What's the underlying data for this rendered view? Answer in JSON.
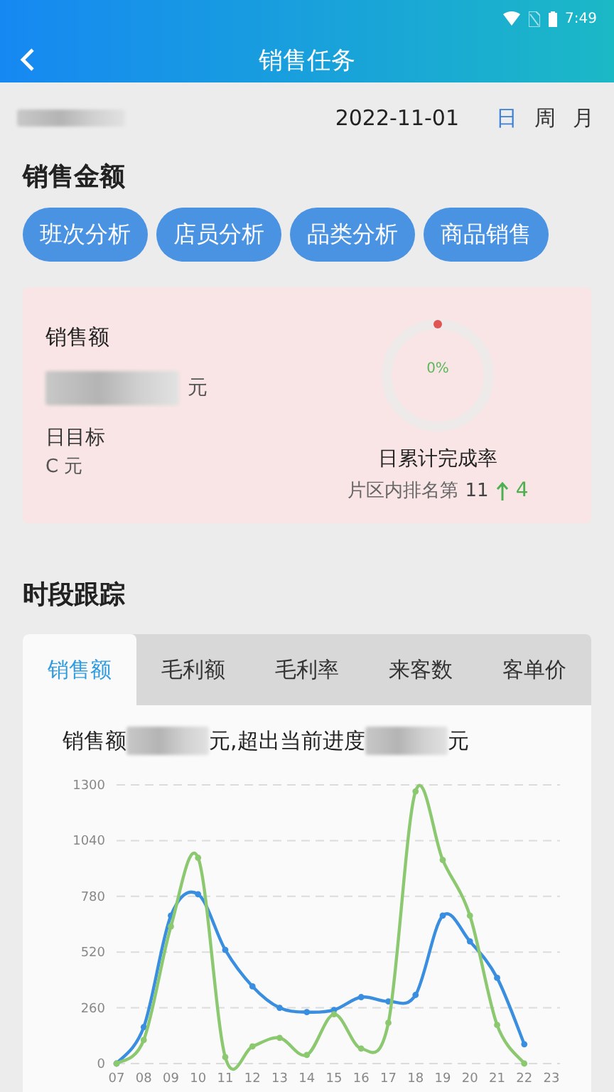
{
  "status_bar": {
    "time": "7:49"
  },
  "header": {
    "title": "销售任务"
  },
  "date_bar": {
    "date": "2022-11-01",
    "periods": [
      {
        "label": "日",
        "selected": true
      },
      {
        "label": "周",
        "selected": false
      },
      {
        "label": "月",
        "selected": false
      }
    ]
  },
  "sales_amount": {
    "title": "销售金额",
    "buttons": [
      "班次分析",
      "店员分析",
      "品类分析",
      "商品销售"
    ],
    "card": {
      "label": "销售额",
      "unit": "元",
      "target_label": "日目标",
      "target_value": "C 元",
      "progress": {
        "level": 0,
        "reading": "0%",
        "caption": "日累计完成率"
      },
      "rank_label": "片区内排名第",
      "rank": "11",
      "rank_change": "4"
    }
  },
  "period_tracking": {
    "title": "时段跟踪",
    "tabs": [
      {
        "label": "销售额",
        "selected": true
      },
      {
        "label": "毛利额",
        "selected": false
      },
      {
        "label": "毛利率",
        "selected": false
      },
      {
        "label": "来客数",
        "selected": false
      },
      {
        "label": "客单价",
        "selected": false
      }
    ],
    "summary_parts": [
      "销售额",
      "元,超出当前进度",
      "元"
    ],
    "chart_data": {
      "type": "line",
      "categories": [
        "07",
        "08",
        "09",
        "10",
        "11",
        "12",
        "13",
        "14",
        "15",
        "16",
        "17",
        "18",
        "19",
        "20",
        "21",
        "22",
        "23"
      ],
      "yticks": [
        0,
        260,
        520,
        780,
        1040,
        1300
      ],
      "ylim": [
        0,
        1300
      ],
      "grid": true,
      "series": [
        {
          "color": "#3a8ee0",
          "marker": true,
          "values": [
            0,
            170,
            690,
            790,
            530,
            360,
            260,
            240,
            250,
            310,
            290,
            320,
            690,
            570,
            400,
            90,
            null
          ]
        },
        {
          "color": "#8cc870",
          "marker": true,
          "values": [
            0,
            110,
            640,
            960,
            30,
            80,
            120,
            40,
            230,
            70,
            190,
            1270,
            950,
            690,
            180,
            0,
            null
          ]
        }
      ]
    }
  }
}
